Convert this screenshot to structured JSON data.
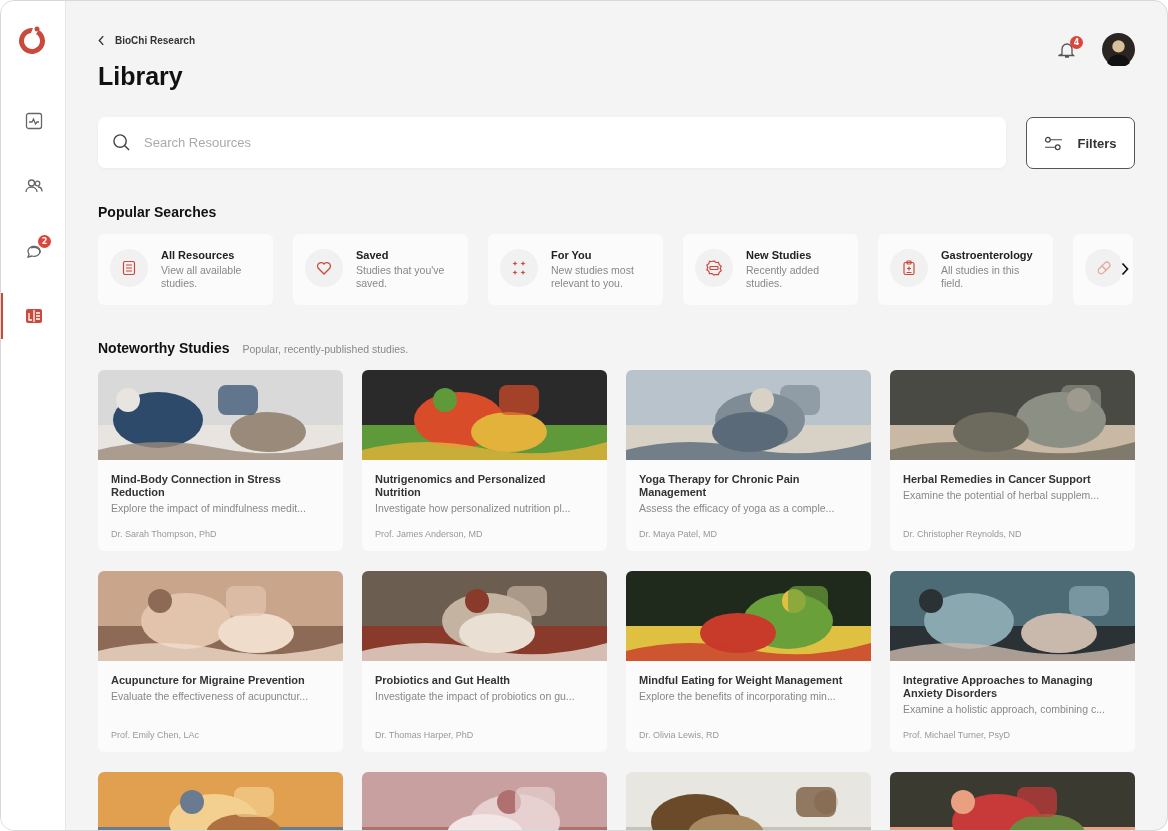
{
  "sidebar": {
    "items": [
      {
        "selected": false
      },
      {
        "selected": false
      },
      {
        "selected": false,
        "badge": "2"
      },
      {
        "selected": true
      }
    ]
  },
  "header": {
    "breadcrumb": "BioChi Research",
    "title": "Library",
    "notification_count": "4"
  },
  "search": {
    "placeholder": "Search Resources",
    "filters_label": "Filters"
  },
  "popular_searches": {
    "title": "Popular Searches",
    "tiles": [
      {
        "kind": "full",
        "title": "All Resources",
        "subtitle": "View all available studies."
      },
      {
        "kind": "full",
        "title": "Saved",
        "subtitle": "Studies that you've saved."
      },
      {
        "kind": "full",
        "title": "For You",
        "subtitle": "New studies most relevant to you."
      },
      {
        "kind": "full",
        "title": "New Studies",
        "subtitle": "Recently added studies."
      },
      {
        "kind": "full",
        "title": "Gastroenterology",
        "subtitle": "All studies in this field."
      },
      {
        "kind": "partial"
      }
    ]
  },
  "noteworthy": {
    "title": "Noteworthy Studies",
    "subtitle": "Popular, recently-published studies.",
    "studies": [
      {
        "kind": "full",
        "title": "Mind-Body Connection in Stress Reduction",
        "description": "Explore the impact of mindfulness medit...",
        "author": "Dr. Sarah Thompson, PhD"
      },
      {
        "kind": "full",
        "title": "Nutrigenomics and Personalized Nutrition",
        "description": "Investigate how personalized nutrition pl...",
        "author": "Prof. James Anderson, MD"
      },
      {
        "kind": "full",
        "title": "Yoga Therapy for Chronic Pain Management",
        "description": "Assess the efficacy of yoga as a comple...",
        "author": "Dr. Maya Patel, MD"
      },
      {
        "kind": "full",
        "title": "Herbal Remedies in Cancer Support",
        "description": "Examine the potential of herbal supplem...",
        "author": "Dr. Christopher Reynolds, ND"
      },
      {
        "kind": "full",
        "title": "Acupuncture for Migraine Prevention",
        "description": "Evaluate the effectiveness of acupunctur...",
        "author": "Prof. Emily Chen, LAc"
      },
      {
        "kind": "full",
        "title": "Probiotics and Gut Health",
        "description": "Investigate the impact of probiotics on gu...",
        "author": "Dr. Thomas Harper, PhD"
      },
      {
        "kind": "full",
        "title": "Mindful Eating for Weight Management",
        "description": "Explore the benefits of incorporating min...",
        "author": "Dr. Olivia Lewis, RD"
      },
      {
        "kind": "full",
        "title": "Integrative Approaches to Managing Anxiety Disorders",
        "description": "Examine a holistic approach, combining c...",
        "author": "Prof. Michael Turner, PsyD"
      },
      {
        "kind": "picture"
      },
      {
        "kind": "picture"
      },
      {
        "kind": "picture"
      },
      {
        "kind": "picture"
      }
    ]
  }
}
